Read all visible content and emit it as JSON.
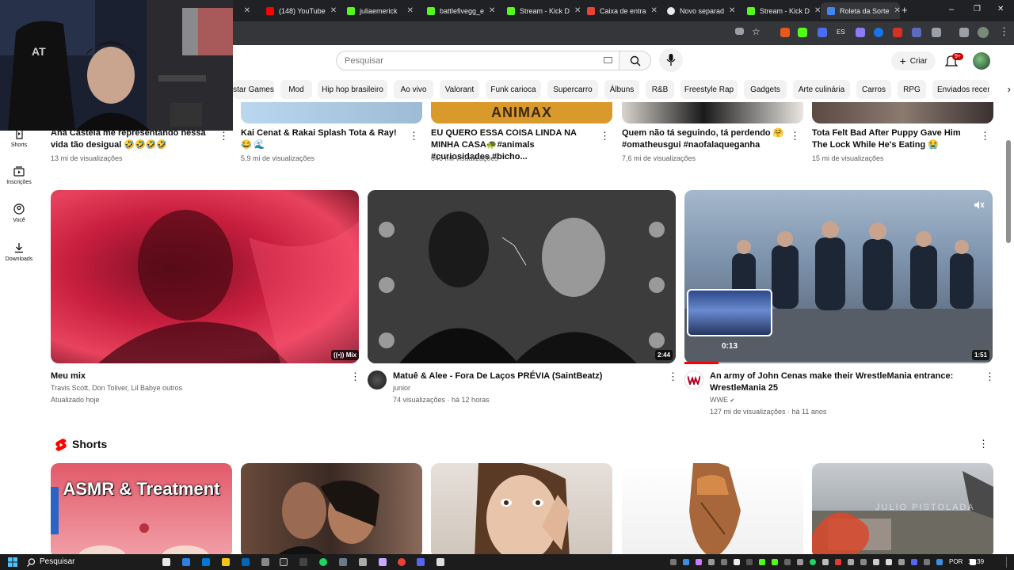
{
  "browser": {
    "tabs": [
      {
        "label": "",
        "color": "#ff0000"
      },
      {
        "label": "(148) YouTube",
        "color": "#ff0000"
      },
      {
        "label": "juliaemerick",
        "color": "#53fc18"
      },
      {
        "label": "battlefivegg_e",
        "color": "#53fc18"
      },
      {
        "label": "Stream - Kick D",
        "color": "#53fc18"
      },
      {
        "label": "Caixa de entra",
        "color": "#ea4335"
      },
      {
        "label": "Novo separad",
        "color": "#e8eaed"
      },
      {
        "label": "Stream - Kick D",
        "color": "#53fc18"
      },
      {
        "label": "Roleta da Sorte",
        "color": "#4285f4"
      }
    ],
    "new_tab": "+",
    "minimize": "–",
    "restore": "❐",
    "close": "✕"
  },
  "header": {
    "search_placeholder": "Pesquisar",
    "create_label": "Criar",
    "notifications_badge": "9+"
  },
  "chips": [
    "star Games",
    "Mod",
    "Hip hop brasileiro",
    "Ao vivo",
    "Valorant",
    "Funk carioca",
    "Supercarro",
    "Álbuns",
    "R&B",
    "Freestyle Rap",
    "Gadgets",
    "Arte culinária",
    "Carros",
    "RPG",
    "Enviados recen"
  ],
  "sidebar": [
    {
      "label": "Shorts",
      "icon": "shorts-icon"
    },
    {
      "label": "Inscrições",
      "icon": "subscriptions-icon"
    },
    {
      "label": "Você",
      "icon": "you-icon"
    },
    {
      "label": "Downloads",
      "icon": "download-icon"
    }
  ],
  "top_row": [
    {
      "title": "Ana Castela me representando nessa vida tão desigual 🤣🤣🤣🤣",
      "views": "13 mi de visualizações"
    },
    {
      "title": "Kai Cenat & Rakai Splash Tota & Ray! 😂 🌊",
      "views": "5,9 mi de visualizações",
      "thumb_text": ""
    },
    {
      "title": "EU QUERO ESSA COISA LINDA NA MINHA CASA🐢#animals #curiosidades #bicho...",
      "views": "646 mil visualizações",
      "thumb_text": "ANIMAX"
    },
    {
      "title": "Quem não tá seguindo, tá perdendo 🤗 #omatheusgui #naofalaqueganha",
      "views": "7,6 mi de visualizações"
    },
    {
      "title": "Tota Felt Bad After Puppy Gave Him The Lock While He's Eating 😭",
      "views": "15 mi de visualizações"
    }
  ],
  "videos": [
    {
      "title": "Meu mix",
      "line1": "Travis Scott, Don Toliver, Lil Babye outros",
      "line2": "Atualizado hoje",
      "badge": "Mix"
    },
    {
      "title": "Matuê & Alee - Fora De Laços PRÉVIA (SaintBeatz)",
      "line1": "junior",
      "line2": "74 visualizações · há 12 horas",
      "badge": "2:44"
    },
    {
      "title": "An army of John Cenas make their WrestleMania entrance: WrestleMania 25",
      "line1": "WWE",
      "line2": "127 mi de visualizações · há 11 anos",
      "badge": "1:51",
      "preview_time": "0:13",
      "verified": "✔"
    }
  ],
  "shorts": {
    "section_title": "Shorts",
    "items": [
      {
        "thumb_text": "ASMR   & Treatment"
      },
      {
        "thumb_text": ""
      },
      {
        "thumb_text": ""
      },
      {
        "thumb_text": ""
      },
      {
        "thumb_text": "JULIO PISTOLADA"
      }
    ]
  },
  "taskbar": {
    "search_placeholder": "Pesquisar",
    "language": "POR",
    "time": "19:39"
  }
}
